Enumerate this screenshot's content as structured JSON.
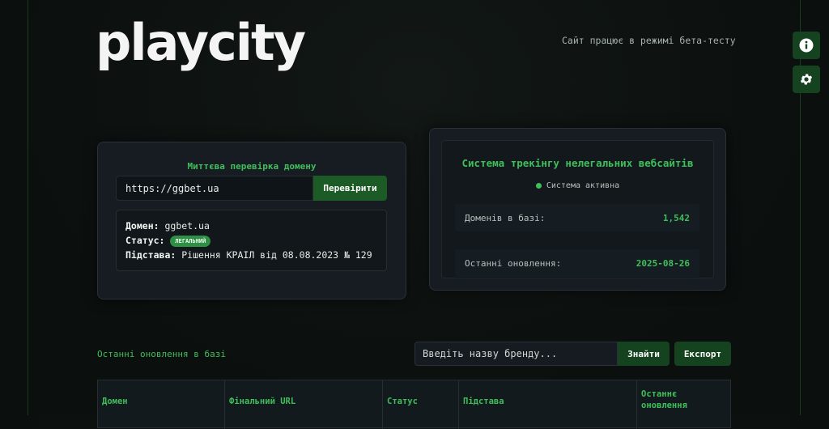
{
  "header": {
    "logo": "playcity",
    "beta_notice": "Сайт працює в режимі бета-тесту"
  },
  "side_buttons": {
    "info_icon": "info-icon",
    "settings_icon": "gear-icon"
  },
  "domain_check": {
    "title": "Миттєва перевірка домену",
    "input_value": "https://ggbet.ua",
    "button_label": "Перевірити",
    "result": {
      "domain_label": "Домен:",
      "domain_value": "ggbet.ua",
      "status_label": "Статус:",
      "status_value": "ЛЕГАЛЬНИЙ",
      "basis_label": "Підстава:",
      "basis_value": "Рішення КРАІЛ від 08.08.2023 № 129"
    }
  },
  "tracking": {
    "title": "Система трекінгу нелегальних вебсайтів",
    "status": "Система активна",
    "stats": [
      {
        "label": "Доменів в базі:",
        "value": "1,542"
      },
      {
        "label": "Останні оновлення:",
        "value": "2025-08-26"
      }
    ]
  },
  "updates": {
    "title": "Останні оновлення в базі",
    "search_placeholder": "Введіть назву бренду...",
    "find_label": "Знайти",
    "export_label": "Експорт",
    "columns": [
      "Домен",
      "Фінальний URL",
      "Статус",
      "Підстава",
      "Останнє оновлення"
    ]
  },
  "colors": {
    "accent": "#3fbf5a",
    "button": "#15421f",
    "background": "#0b0f0e"
  }
}
